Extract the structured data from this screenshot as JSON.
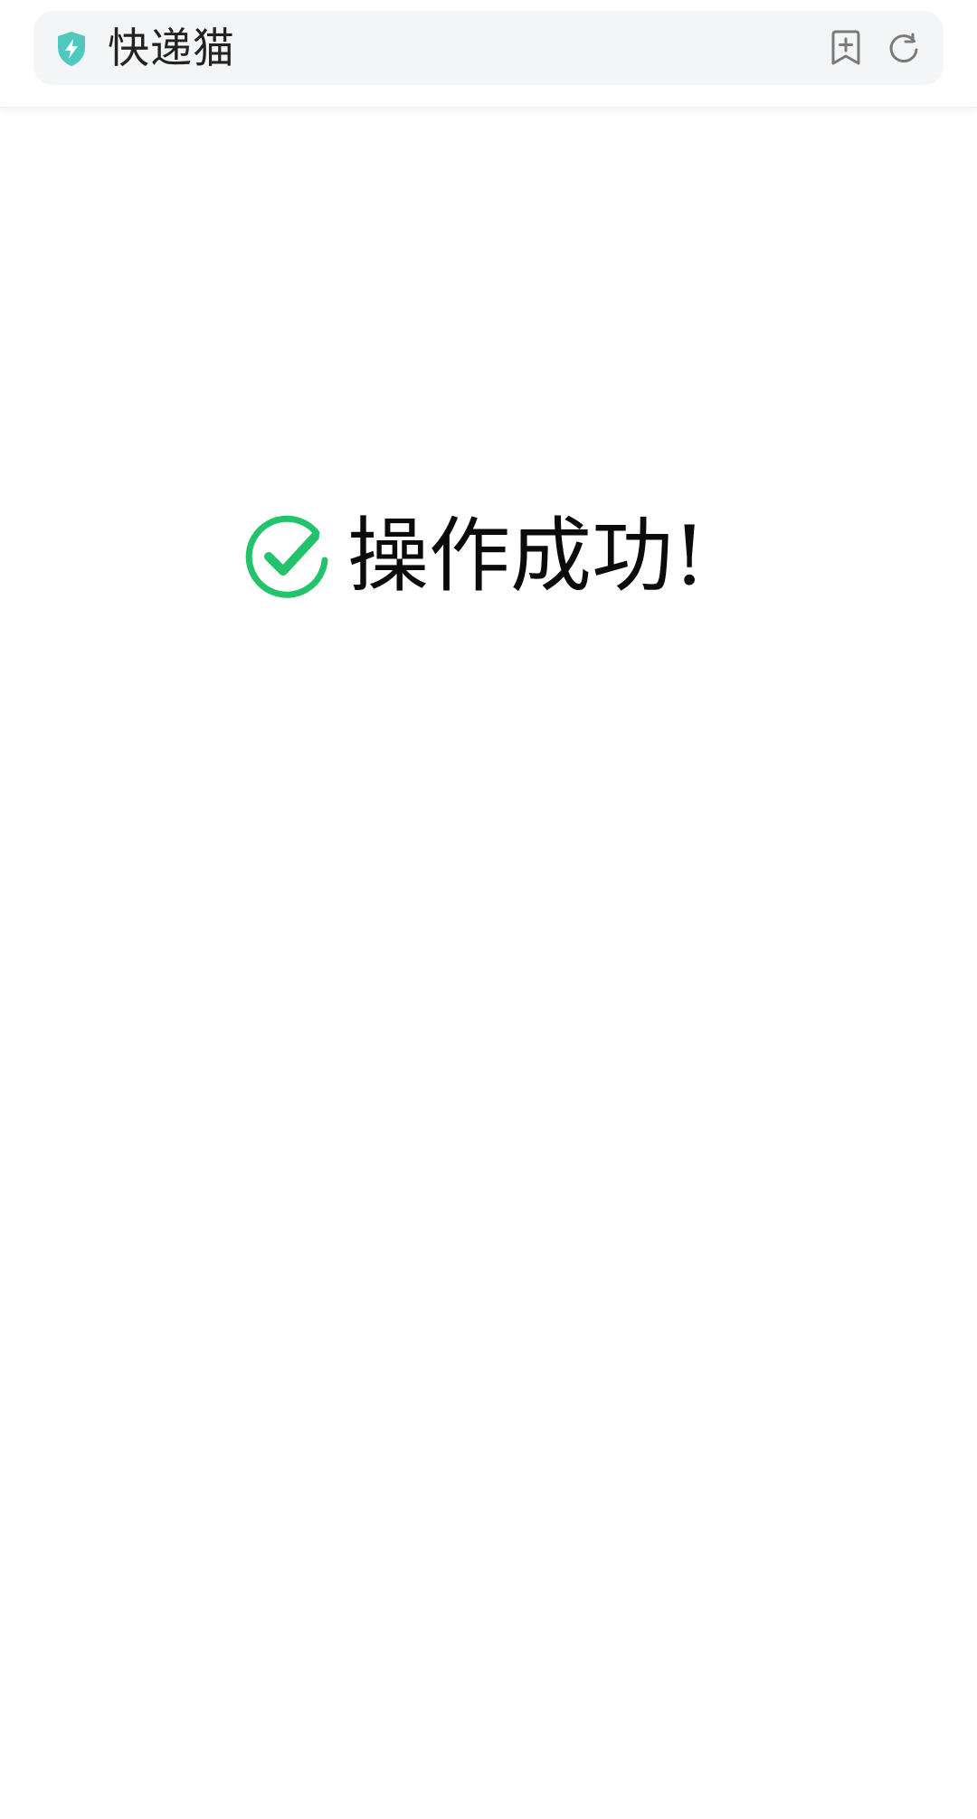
{
  "header": {
    "site_title": "快递猫",
    "icons": {
      "security": "shield-lightning-icon",
      "bookmark": "bookmark-add-icon",
      "refresh": "refresh-icon"
    },
    "colors": {
      "shield": "#4fc9be",
      "icon": "#7a7a7a"
    }
  },
  "main": {
    "message": "操作成功!",
    "icon": "check-circle-icon",
    "accent_color": "#22c36a"
  }
}
